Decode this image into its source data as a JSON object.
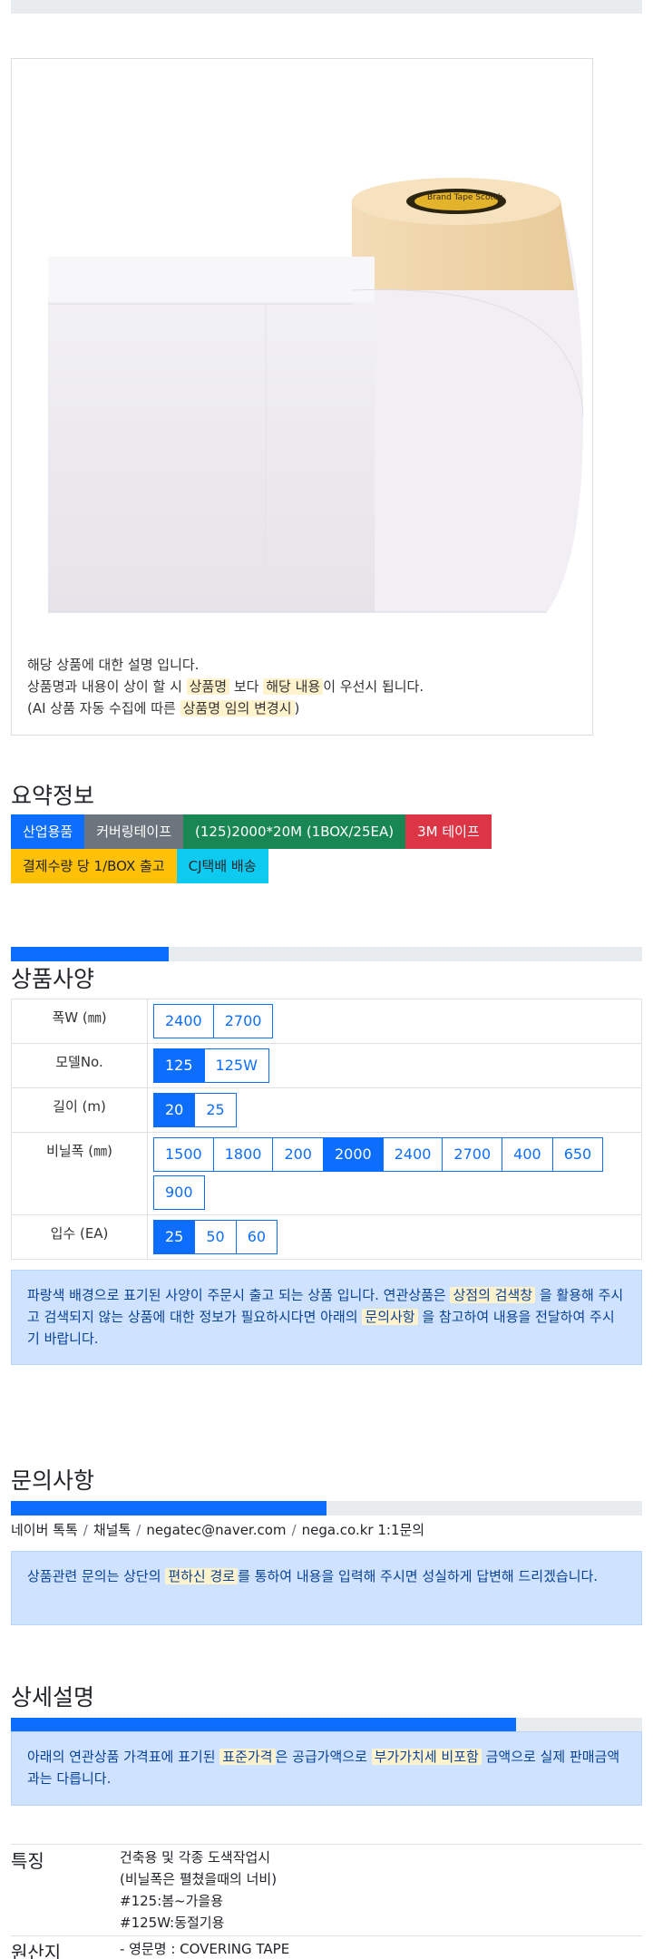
{
  "product": {
    "image_alt": "Scotch Brand Tape covering tape roll",
    "tape_text": "Brand Tape Scotch",
    "description": {
      "line1": "해당 상품에 대한 설명 입니다.",
      "line2_a": "상품명과 내용이 상이 할 시",
      "line2_hl1": "상품명",
      "line2_b": "보다",
      "line2_hl2": "해당 내용",
      "line2_c": "이 우선시 됩니다.",
      "line3_a": "(AI 상품 자동 수집에 따른",
      "line3_hl": "상품명 임의 변경시",
      "line3_b": ")"
    }
  },
  "summary": {
    "title": "요약정보",
    "badges": [
      {
        "label": "산업용품",
        "color": "#0d6efd"
      },
      {
        "label": "커버링테이프",
        "color": "#6c757d"
      },
      {
        "label": "(125)2000*20M (1BOX/25EA)",
        "color": "#198754"
      },
      {
        "label": "3M 테이프",
        "color": "#dc3545"
      },
      {
        "label": "결제수량 당 1/BOX 출고",
        "color": "#ffc107"
      },
      {
        "label": "CJ택배 배송",
        "color": "#0dcaf0"
      }
    ]
  },
  "specs": {
    "title": "상품사양",
    "progress": 0.25,
    "rows": [
      {
        "label": "폭W (㎜)",
        "options": [
          "2400",
          "2700"
        ],
        "selected": null
      },
      {
        "label": "모델No.",
        "options": [
          "125",
          "125W"
        ],
        "selected": "125"
      },
      {
        "label": "길이 (m)",
        "options": [
          "20",
          "25"
        ],
        "selected": "20"
      },
      {
        "label": "비닐폭 (㎜)",
        "options": [
          "1500",
          "1800",
          "200",
          "2000",
          "2400",
          "2700",
          "400",
          "650",
          "900"
        ],
        "selected": "2000"
      },
      {
        "label": "입수 (EA)",
        "options": [
          "25",
          "50",
          "60"
        ],
        "selected": "25"
      }
    ],
    "notice": {
      "a": "파랑색 배경으로 표기된 사양이 주문시 출고 되는 상품 입니다. 연관상품은",
      "hl1": "상점의 검색창",
      "b": "을 활용해 주시고 검색되지 않는 상품에 대한 정보가 필요하시다면 아래의",
      "hl2": "문의사항",
      "c": "을 참고하여 내용을 전달하여 주시기 바랍니다."
    }
  },
  "inquiry": {
    "title": "문의사항",
    "progress": 0.5,
    "links": [
      "네이버 톡톡",
      "채널톡",
      "negatec@naver.com",
      "nega.co.kr 1:1문의"
    ],
    "separator": "/",
    "notice": {
      "a": "상품관련 문의는 상단의",
      "hl": "편하신 경로",
      "b": "를 통하여 내용을 입력해 주시면 성실하게 답변해 드리겠습니다."
    }
  },
  "details": {
    "title": "상세설명",
    "progress": 0.8,
    "notice": {
      "a": "아래의 연관상품 가격표에 표기된",
      "hl1": "표준가격",
      "b": "은 공급가액으로",
      "hl2": "부가가치세 비포함",
      "c": "금액으로 실제 판매금액과는 다릅니다."
    },
    "features": {
      "label": "특징",
      "lines": [
        "건축용 및 각종 도색작업시",
        "(비닐폭은 펼쳤을때의 너비)",
        "#125:봄~가을용",
        "#125W:동절기용"
      ]
    },
    "origin": {
      "label": "원산지",
      "value": "- 영문명 : COVERING TAPE"
    }
  }
}
